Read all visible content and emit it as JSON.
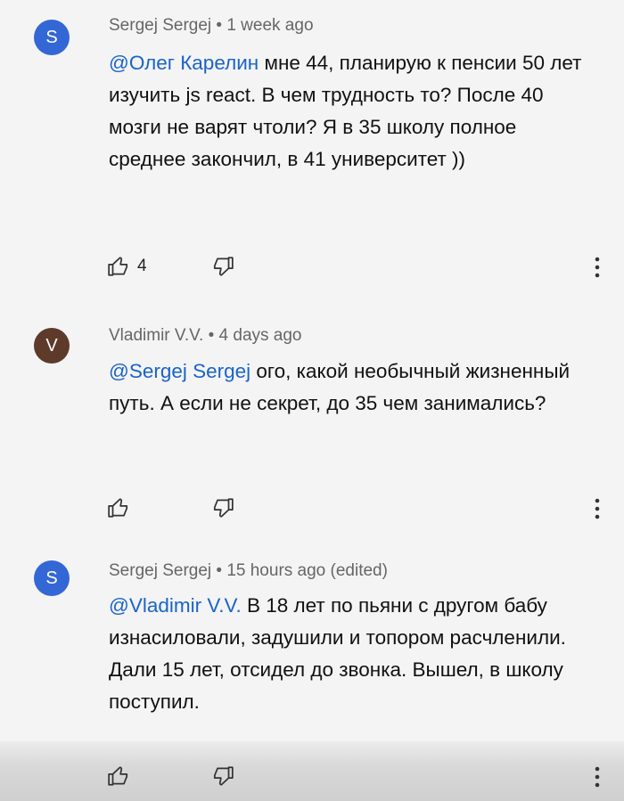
{
  "colors": {
    "avatar_s": "#3367d6",
    "avatar_v": "#5d3a2a",
    "mention": "#1a64c8"
  },
  "comments": [
    {
      "avatar_letter": "S",
      "meta": "Sergej Sergej • 1 week ago",
      "mention": "@Олег Карелин",
      "text": " мне 44, планирую к пенсии 50 лет изучить js react. В чем трудность то? После 40 мозги не варят чтоли? Я в 35 школу полное среднее закончил, в 41 университет ))",
      "likes": "4"
    },
    {
      "avatar_letter": "V",
      "meta": "Vladimir V.V. • 4 days ago",
      "mention": "@Sergej Sergej",
      "text": " ого, какой необычный жизненный путь. А если не секрет, до 35 чем занимались?",
      "likes": ""
    },
    {
      "avatar_letter": "S",
      "meta": "Sergej Sergej • 15 hours ago (edited)",
      "mention": "@Vladimir V.V.",
      "text": " В 18 лет по пьяни с другом бабу изнасиловали, задушили и топором расчленили. Дали 15 лет, отсидел до звонка. Вышел, в школу поступил.",
      "likes": ""
    }
  ]
}
